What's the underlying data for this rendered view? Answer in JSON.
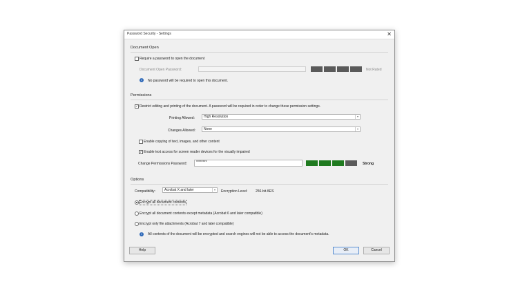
{
  "window": {
    "title": "Password Security - Settings",
    "close_glyph": "✕"
  },
  "document_open": {
    "section_title": "Document Open",
    "require_password_label": "Require a password to open the document",
    "require_password_checked": false,
    "password_label": "Document Open Password:",
    "password_value": "",
    "strength_label": "Not Rated",
    "strength_colors": [
      "#5a5a5a",
      "#5a5a5a",
      "#5a5a5a",
      "#5a5a5a"
    ],
    "info_text": "No password will be required to open this document."
  },
  "permissions": {
    "section_title": "Permissions",
    "restrict_label": "Restrict editing and printing of the document. A password will be required in order to change these permission settings.",
    "restrict_checked": true,
    "printing_label": "Printing Allowed:",
    "printing_value": "High Resolution",
    "changes_label": "Changes Allowed:",
    "changes_value": "None",
    "copy_label": "Enable copying of text, images, and other content",
    "copy_checked": false,
    "screen_reader_label": "Enable text access for screen reader devices for the visually impaired",
    "screen_reader_checked": true,
    "perm_password_label": "Change Permissions Password:",
    "perm_password_value": "********",
    "strength_label": "Strong",
    "strength_colors": [
      "#1f7a1f",
      "#1f7a1f",
      "#1f7a1f",
      "#5a5a5a"
    ]
  },
  "options": {
    "section_title": "Options",
    "compat_label": "Compatibility:",
    "compat_value": "Acrobat X and later",
    "encryption_label": "Encryption  Level:",
    "encryption_value": "256-bit AES",
    "radio_all": "Encrypt all document contents",
    "radio_except_metadata": "Encrypt all document contents except metadata (Acrobat 6 and later compatible)",
    "radio_attachments": "Encrypt only file attachments (Acrobat 7 and later compatible)",
    "selected": "all",
    "info_text": "All contents of the document will be encrypted and search engines will not be able to access the document's metadata."
  },
  "buttons": {
    "help": "Help",
    "ok": "OK",
    "cancel": "Cancel"
  },
  "icons": {
    "info": "i",
    "check": "✓",
    "dropdown_arrow": "▾"
  }
}
